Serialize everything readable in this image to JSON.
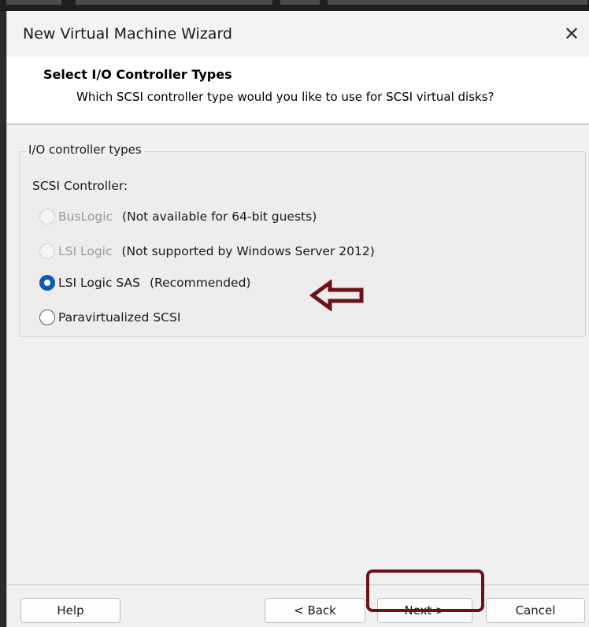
{
  "window": {
    "title": "New Virtual Machine Wizard",
    "close_glyph": "✕"
  },
  "header": {
    "title": "Select I/O Controller Types",
    "subtitle": "Which SCSI controller type would you like to use for SCSI virtual disks?"
  },
  "group": {
    "legend": "I/O controller types",
    "label": "SCSI Controller:",
    "options": [
      {
        "label": "BusLogic",
        "note": "(Not available for 64-bit guests)",
        "state": "disabled"
      },
      {
        "label": "LSI Logic",
        "note": "(Not supported by Windows Server 2012)",
        "state": "disabled"
      },
      {
        "label": "LSI Logic SAS",
        "note": "(Recommended)",
        "state": "checked"
      },
      {
        "label": "Paravirtualized SCSI",
        "note": "",
        "state": "unchecked"
      }
    ]
  },
  "buttons": {
    "help": "Help",
    "back": "< Back",
    "next": "Next >",
    "cancel": "Cancel"
  },
  "colors": {
    "accent_radio": "#0b5cb8",
    "annotation": "#6b1218"
  },
  "icons": {
    "close": "close-icon",
    "annotation_arrow": "left-arrow-annotation-icon"
  }
}
